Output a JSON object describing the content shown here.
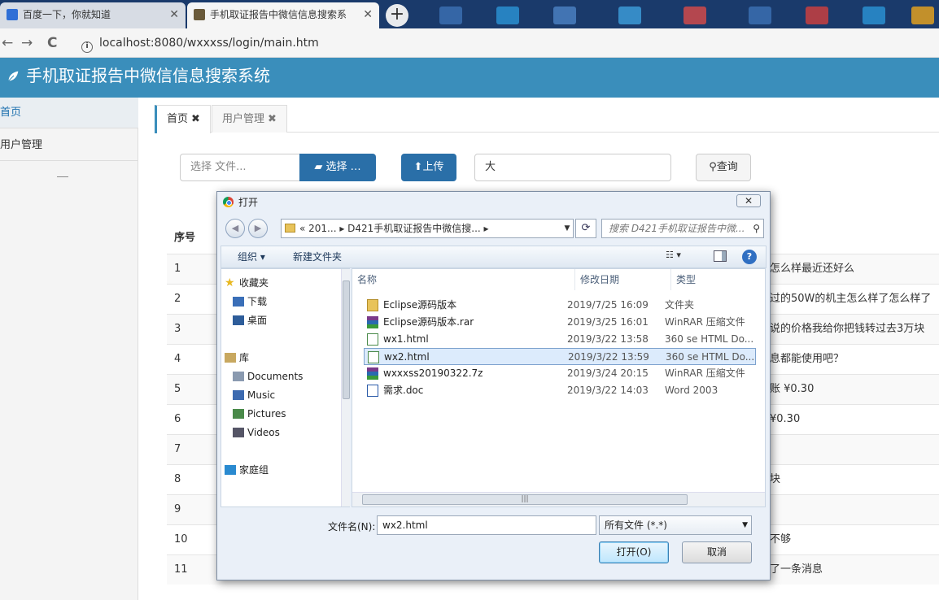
{
  "browser": {
    "tabs": [
      {
        "title": "百度一下，你就知道",
        "active": false
      },
      {
        "title": "手机取证报告中微信信息搜索系",
        "active": true
      }
    ],
    "new_tab": "+",
    "close": "✕",
    "url": "localhost:8080/wxxxss/login/main.htm",
    "info_symbol": "i",
    "nav": {
      "back": "←",
      "forward": "→",
      "reload": "C"
    }
  },
  "app": {
    "title": "手机取证报告中微信信息搜索系统",
    "sidebar": [
      {
        "label": "首页",
        "active": true
      },
      {
        "label": "用户管理",
        "active": false
      }
    ],
    "page_tabs": [
      {
        "label": "首页",
        "close": "✖",
        "active": true
      },
      {
        "label": "用户管理",
        "close": "✖",
        "active": false
      }
    ],
    "toolbar": {
      "file_placeholder": "选择 文件...",
      "choose_label": "选择 …",
      "upload_label": "上传",
      "search_value": "大",
      "query_label": "查询"
    },
    "table": {
      "header_no": "序号",
      "rows": [
        {
          "no": "1",
          "tail": "怎么样最近还好么"
        },
        {
          "no": "2",
          "tail": "过的50W的机主怎么样了怎么样了"
        },
        {
          "no": "3",
          "tail": "说的价格我给你把钱转过去3万块"
        },
        {
          "no": "4",
          "tail": "息都能使用吧？"
        },
        {
          "no": "5",
          "tail": "账 ¥0.30"
        },
        {
          "no": "6",
          "tail": "¥0.30"
        },
        {
          "no": "7",
          "tail": ""
        },
        {
          "no": "8",
          "tail": "块"
        },
        {
          "no": "9",
          "tail": ""
        },
        {
          "no": "10",
          "tail": "不够"
        },
        {
          "no": "11",
          "tail": "了一条消息"
        }
      ]
    }
  },
  "dialog": {
    "title": "打开",
    "close": "✕",
    "back": "◀",
    "forward": "▶",
    "breadcrumb": "« 201... ▸ D421手机取证报告中微信搜... ▸",
    "dropdown_arrow": "▼",
    "refresh": "⟳",
    "search_placeholder": "搜索 D421手机取证报告中微...",
    "search_icon": "⚲",
    "organize": "组织 ▾",
    "new_folder": "新建文件夹",
    "view_icon": "☷ ▾",
    "help": "?",
    "nav_pane": [
      {
        "label": "收藏夹",
        "icon": "star-icon",
        "indent": 0
      },
      {
        "label": "下载",
        "icon": "download-folder-icon",
        "indent": 1
      },
      {
        "label": "桌面",
        "icon": "desktop-icon",
        "indent": 1
      },
      {
        "label": "库",
        "icon": "library-icon",
        "indent": 0
      },
      {
        "label": "Documents",
        "icon": "documents-icon",
        "indent": 1
      },
      {
        "label": "Music",
        "icon": "music-icon",
        "indent": 1
      },
      {
        "label": "Pictures",
        "icon": "pictures-icon",
        "indent": 1
      },
      {
        "label": "Videos",
        "icon": "videos-icon",
        "indent": 1
      },
      {
        "label": "家庭组",
        "icon": "homegroup-icon",
        "indent": 0
      }
    ],
    "columns": {
      "name": "名称",
      "date": "修改日期",
      "type": "类型"
    },
    "files": [
      {
        "name": "Eclipse源码版本",
        "date": "2019/7/25 16:09",
        "type": "文件夹",
        "icon": "folder-icon",
        "selected": false
      },
      {
        "name": "Eclipse源码版本.rar",
        "date": "2019/3/25 16:01",
        "type": "WinRAR 压缩文件",
        "icon": "winrar-icon",
        "selected": false
      },
      {
        "name": "wx1.html",
        "date": "2019/3/22 13:58",
        "type": "360 se HTML Do...",
        "icon": "html-file-icon",
        "selected": false
      },
      {
        "name": "wx2.html",
        "date": "2019/3/22 13:59",
        "type": "360 se HTML Do...",
        "icon": "html-file-icon",
        "selected": true
      },
      {
        "name": "wxxxss20190322.7z",
        "date": "2019/3/24 20:15",
        "type": "WinRAR 压缩文件",
        "icon": "winrar-icon",
        "selected": false
      },
      {
        "name": "需求.doc",
        "date": "2019/3/22 14:03",
        "type": "Word 2003",
        "icon": "word-doc-icon",
        "selected": false
      }
    ],
    "filename_label": "文件名(N):",
    "filename_value": "wx2.html",
    "filetype": "所有文件 (*.*)",
    "open_label": "打开(O)",
    "cancel_label": "取消"
  },
  "colors": {
    "header_bg": "#3a8ebb",
    "button_blue": "#2a6fa8",
    "tabbar_bg": "#1a3a6b",
    "selection_bg": "#dcebfc"
  }
}
